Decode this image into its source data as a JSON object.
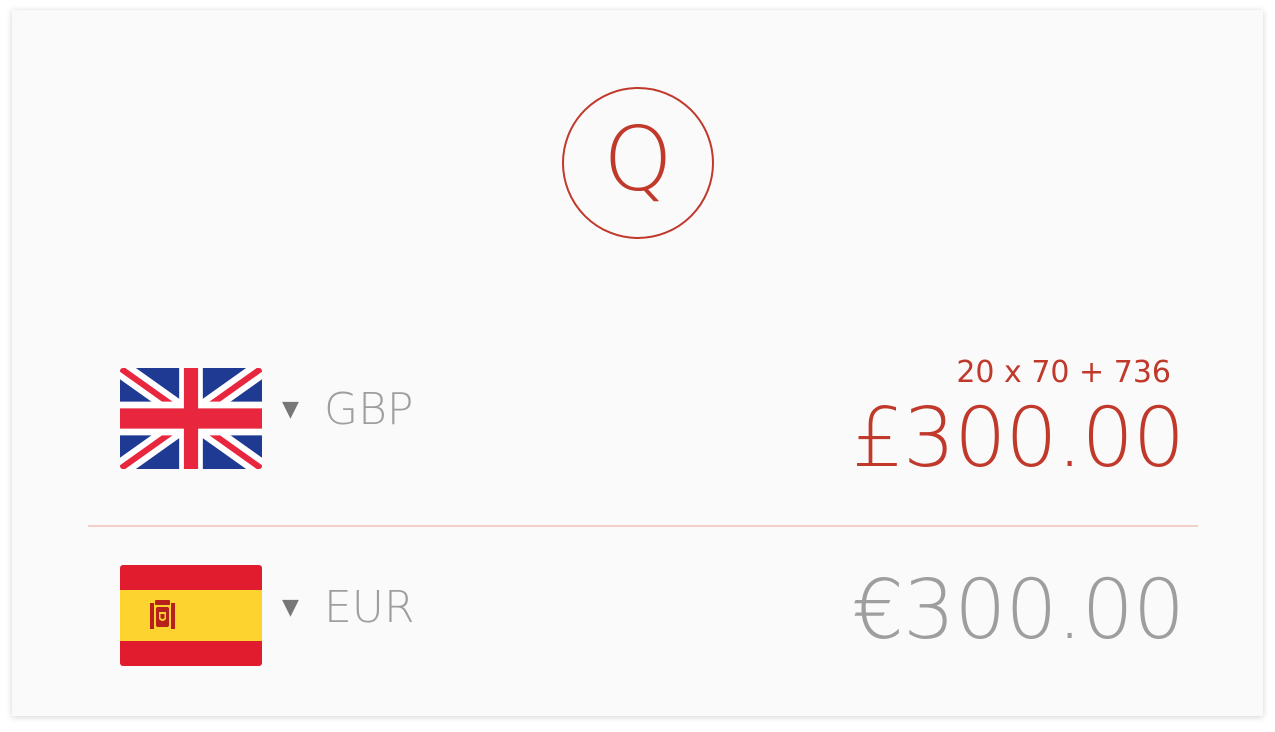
{
  "app": {
    "logo_letter": "Q",
    "accent_color": "#c0392b"
  },
  "from": {
    "flag_icon": "uk-flag-icon",
    "caret": "▼",
    "currency_code": "GBP",
    "formula": "20 x 70 + 736",
    "amount": "£300.00"
  },
  "to": {
    "flag_icon": "spain-flag-icon",
    "caret": "▼",
    "currency_code": "EUR",
    "amount": "€300.00"
  }
}
